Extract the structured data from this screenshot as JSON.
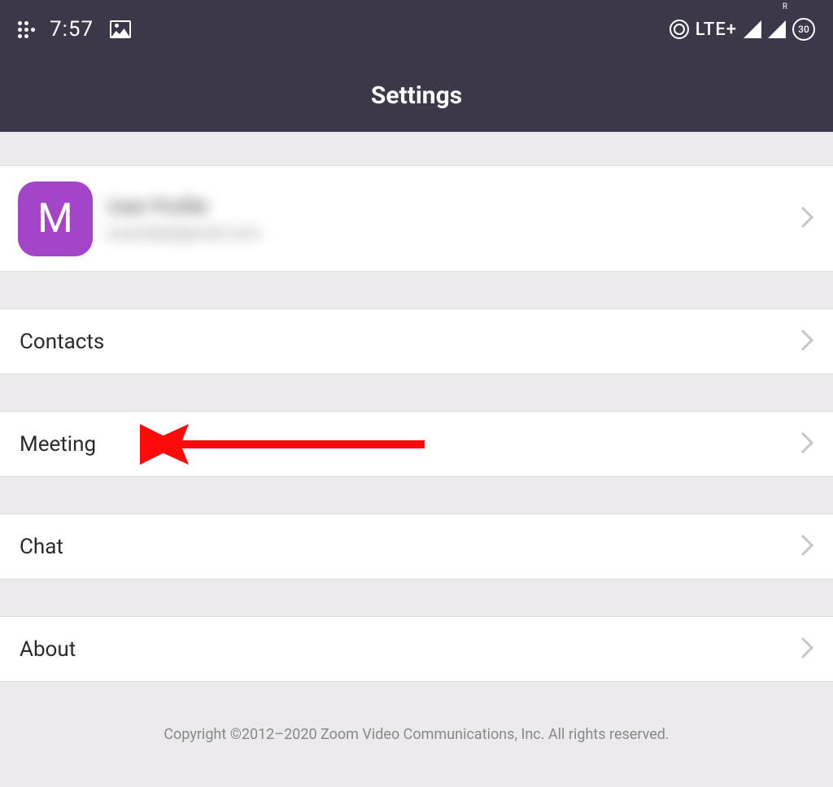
{
  "status_bar": {
    "time": "7:57",
    "network_type": "LTE+",
    "battery_level": "30",
    "roaming_label": "R"
  },
  "header": {
    "title": "Settings"
  },
  "profile": {
    "initial": "M",
    "name": "User Profile",
    "email": "example@gmail.com"
  },
  "menu": {
    "contacts": "Contacts",
    "meeting": "Meeting",
    "chat": "Chat",
    "about": "About"
  },
  "footer": {
    "copyright": "Copyright ©2012–2020 Zoom Video Communications, Inc. All rights reserved."
  },
  "annotation": {
    "target": "meeting",
    "color": "#ff0a0a"
  }
}
